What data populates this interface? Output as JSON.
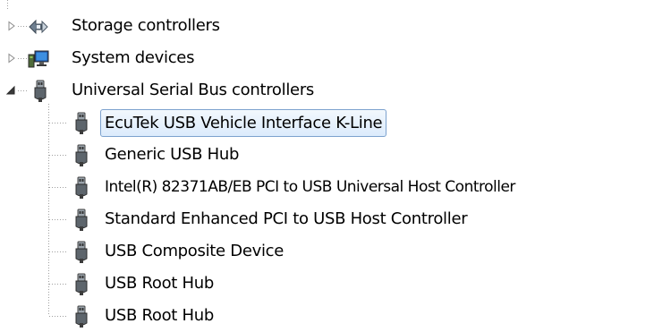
{
  "tree": {
    "top_nodes": [
      {
        "label": "Storage controllers",
        "icon": "storage-controller-icon",
        "expanded": false
      },
      {
        "label": "System devices",
        "icon": "system-devices-icon",
        "expanded": false
      },
      {
        "label": "Universal Serial Bus controllers",
        "icon": "usb-plug-icon",
        "expanded": true
      }
    ],
    "usb_children": [
      {
        "label": "EcuTek USB Vehicle Interface K-Line",
        "icon": "usb-plug-icon",
        "selected": true
      },
      {
        "label": "Generic USB Hub",
        "icon": "usb-plug-icon",
        "selected": false
      },
      {
        "label": "Intel(R) 82371AB/EB PCI to USB Universal Host Controller",
        "icon": "usb-plug-icon",
        "selected": false
      },
      {
        "label": "Standard Enhanced PCI to USB Host Controller",
        "icon": "usb-plug-icon",
        "selected": false
      },
      {
        "label": "USB Composite Device",
        "icon": "usb-plug-icon",
        "selected": false
      },
      {
        "label": "USB Root Hub",
        "icon": "usb-plug-icon",
        "selected": false
      },
      {
        "label": "USB Root Hub",
        "icon": "usb-plug-icon",
        "selected": false
      }
    ]
  },
  "colors": {
    "selection_border": "#7da2ce",
    "selection_fill_top": "#f2f8fd",
    "selection_fill_bottom": "#dcebfc",
    "tree_line": "#a0a0a0"
  }
}
